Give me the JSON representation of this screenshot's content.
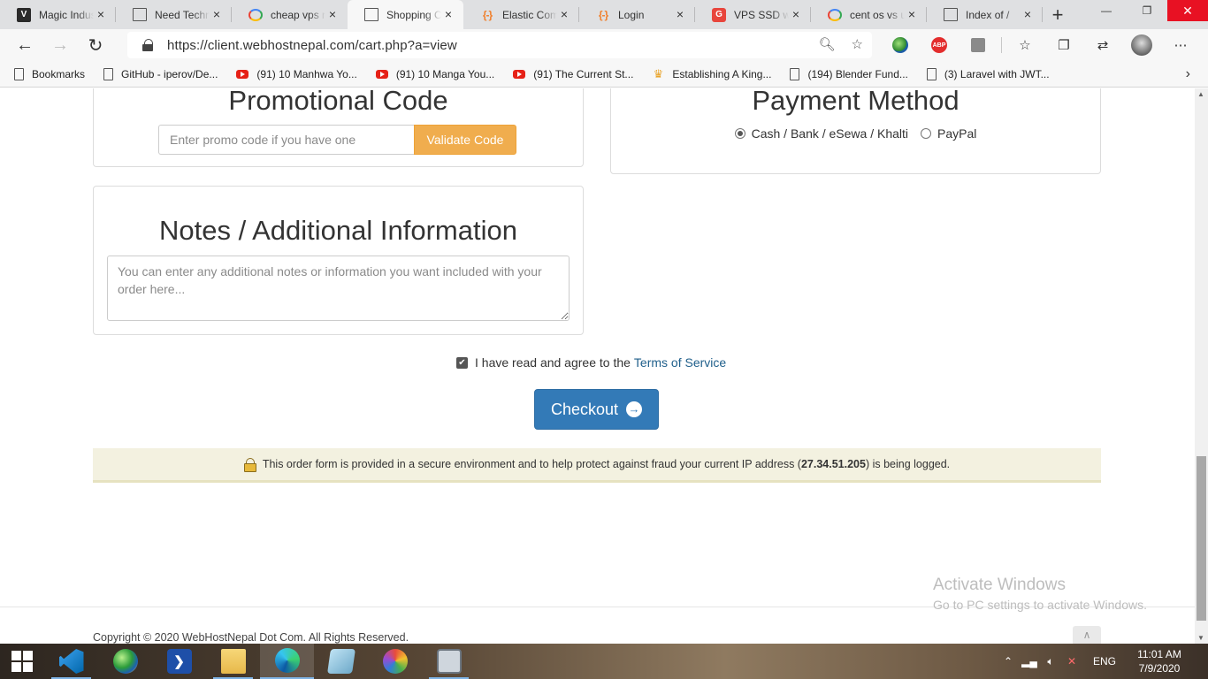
{
  "browser": {
    "tabs": [
      {
        "title": "Magic Indus",
        "icon": "v-letter-icon"
      },
      {
        "title": "Need Techn",
        "icon": "document-icon"
      },
      {
        "title": "cheap vps n",
        "icon": "google-icon"
      },
      {
        "title": "Shopping Ca",
        "icon": "document-icon",
        "active": true
      },
      {
        "title": "Elastic Com",
        "icon": "bracket-icon"
      },
      {
        "title": "Login",
        "icon": "bracket-icon"
      },
      {
        "title": "VPS SSD wit",
        "icon": "g-red-icon"
      },
      {
        "title": "cent os vs u",
        "icon": "google-icon"
      },
      {
        "title": "Index of /",
        "icon": "document-icon"
      }
    ],
    "url": "https://client.webhostnepal.com/cart.php?a=view",
    "bookmarks": [
      {
        "label": "Bookmarks",
        "icon": "document-icon"
      },
      {
        "label": "GitHub - iperov/De...",
        "icon": "document-icon"
      },
      {
        "label": "(91) 10 Manhwa Yo...",
        "icon": "youtube-icon"
      },
      {
        "label": "(91) 10 Manga You...",
        "icon": "youtube-icon"
      },
      {
        "label": "(91) The Current St...",
        "icon": "youtube-icon"
      },
      {
        "label": "Establishing A King...",
        "icon": "crown-icon"
      },
      {
        "label": "(194) Blender Fund...",
        "icon": "document-icon"
      },
      {
        "label": "(3) Laravel with JWT...",
        "icon": "document-icon"
      }
    ]
  },
  "promo": {
    "heading": "Promotional Code",
    "placeholder": "Enter promo code if you have one",
    "button_label": "Validate Code"
  },
  "payment": {
    "heading": "Payment Method",
    "options": [
      {
        "label": "Cash / Bank / eSewa / Khalti",
        "selected": true
      },
      {
        "label": "PayPal",
        "selected": false
      }
    ]
  },
  "notes": {
    "heading": "Notes / Additional Information",
    "placeholder": "You can enter any additional notes or information you want included with your order here..."
  },
  "tos": {
    "text": "I have read and agree to the",
    "link": "Terms of Service",
    "checked": true
  },
  "checkout": {
    "label": "Checkout"
  },
  "secure": {
    "text_before": "This order form is provided in a secure environment and to help protect against fraud your current IP address (",
    "ip": "27.34.51.205",
    "text_after": ") is being logged."
  },
  "watermark": {
    "title": "Activate Windows",
    "subtitle": "Go to PC settings to activate Windows."
  },
  "footer": {
    "copyright": "Copyright © 2020 WebHostNepal Dot Com. All Rights Reserved."
  },
  "taskbar": {
    "apps": [
      "vscode-icon",
      "globe-app-icon",
      "powershell-icon",
      "file-explorer-icon",
      "edge-icon",
      "notes-app-icon",
      "paint-app-icon",
      "monitor-app-icon"
    ],
    "language": "ENG",
    "time": "11:01 AM",
    "date": "7/9/2020"
  },
  "colors": {
    "validate_button": "#f0ad4e",
    "checkout_button": "#337ab7",
    "link": "#1f5f8b",
    "secure_bar": "#f3f1e0"
  }
}
